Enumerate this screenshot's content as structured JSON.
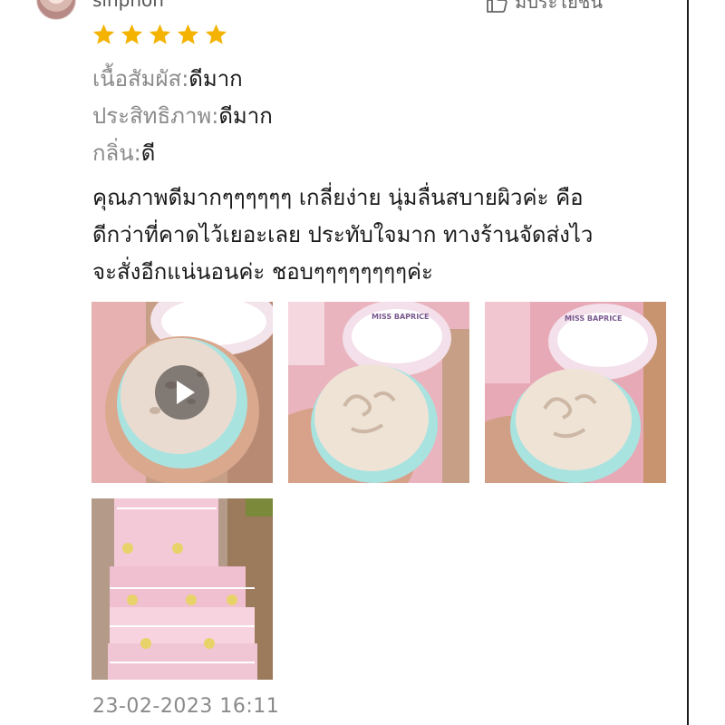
{
  "review": {
    "username": "sinphon",
    "helpful_label": "มีประโยชน์",
    "rating": 5,
    "star_color": "#f5b301",
    "attributes": [
      {
        "key": "เนื้อสัมผัส:",
        "value": "ดีมาก"
      },
      {
        "key": "ประสิทธิภาพ:",
        "value": "ดีมาก"
      },
      {
        "key": "กลิ่น:",
        "value": "ดี"
      }
    ],
    "text_lines": [
      "คุณภาพดีมากๆๆๆๆๆๆ เกลี่ยง่าย นุ่มลื่นสบายผิวค่ะ คือ",
      "ดีกว่าที่คาดไว้เยอะเลย ประทับใจมาก ทางร้านจัดส่งไว",
      "จะสั่งอีกแน่นอนค่ะ ชอบๆๆๆๆๆๆๆๆค่ะ"
    ],
    "media": [
      {
        "kind": "video",
        "icon": "play-icon"
      },
      {
        "kind": "photo",
        "label_text": "MISS BAPRICE"
      },
      {
        "kind": "photo",
        "label_text": "MISS BAPRICE"
      },
      {
        "kind": "photo"
      }
    ],
    "timestamp": "23-02-2023 16:11"
  }
}
